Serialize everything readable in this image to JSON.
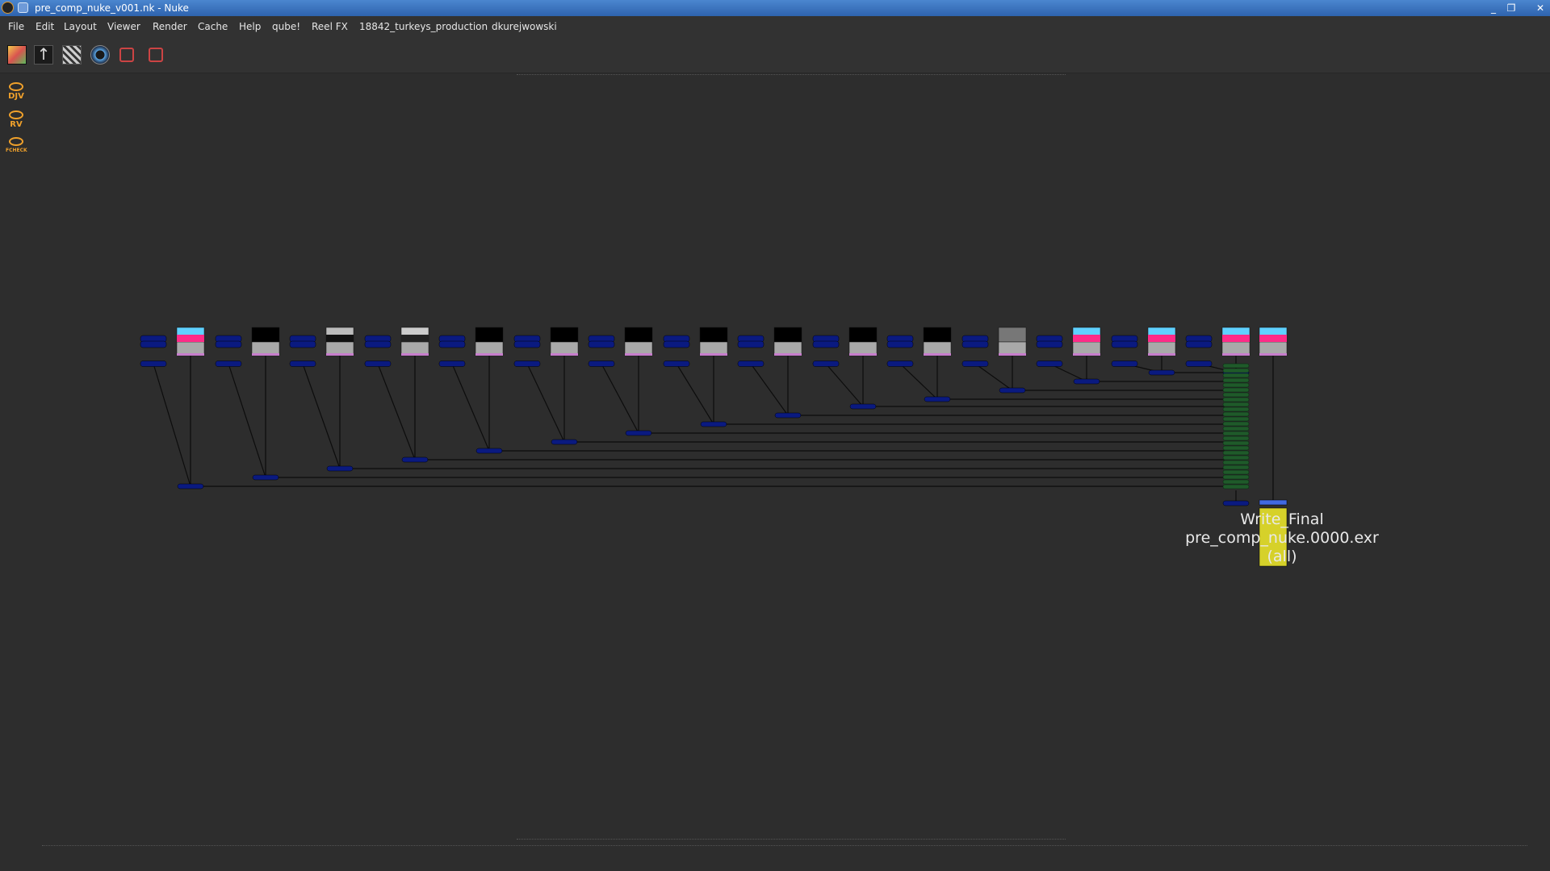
{
  "window": {
    "title": "pre_comp_nuke_v001.nk - Nuke",
    "buttons": [
      "_",
      "❐",
      "✕"
    ]
  },
  "menu": [
    "File",
    "Edit",
    "Layout",
    "Viewer",
    "Render",
    "Cache",
    "Help",
    "qube!",
    "Reel FX",
    "18842_turkeys_production",
    "dkurejwowski"
  ],
  "sidebar": [
    "DJV",
    "RV",
    "FCHECK"
  ],
  "graph": {
    "write_node": {
      "name": "Write_Final",
      "file": "pre_comp_nuke.0000.exr",
      "views": "(all)"
    }
  },
  "colors": {
    "node_blue": "#0a1a80",
    "merge_green": "#1f5a2a",
    "write_yellow": "#d6d12a",
    "background": "#2d2d2d"
  }
}
